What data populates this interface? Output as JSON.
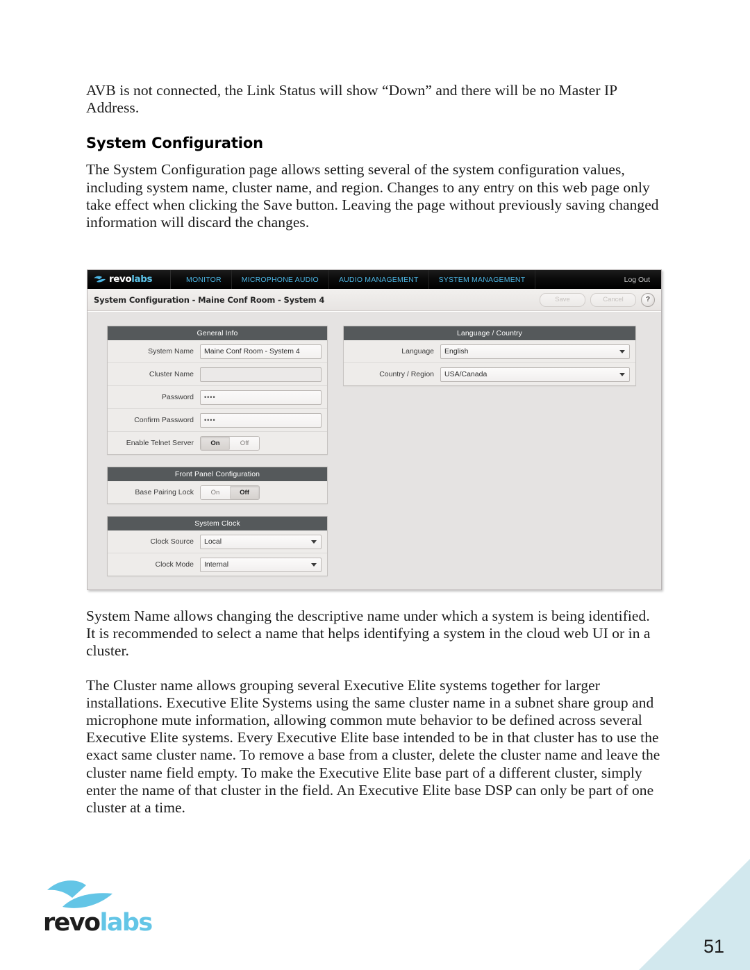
{
  "document": {
    "paragraph_1": "AVB is not connected, the Link Status will show “Down” and there will be no Master IP Address.",
    "heading_1": "System Configuration",
    "paragraph_2": "The System Configuration page allows setting several of the system configuration values, including system name, cluster name, and region.  Changes to any entry on this web page only take effect when clicking the Save button.  Leaving the page without previously saving changed information will discard the changes.",
    "paragraph_3": "System Name allows changing the descriptive name under which a system is being identified.  It is recommended to select a name that helps identifying a system in the cloud web UI or in a cluster.",
    "paragraph_4": "The Cluster name allows grouping several Executive Elite systems together for larger installations.  Executive Elite Systems using the same cluster name in a subnet share group and microphone mute information, allowing common mute behavior to be defined across several Executive Elite systems.  Every Executive Elite base intended to be in that cluster has to use the exact same cluster name.  To remove a base from a cluster, delete the cluster name and leave the cluster name field empty.  To make the Executive Elite base part of a different cluster, simply enter the name of that cluster in the field.  An Executive Elite base DSP can only be part of one cluster at a time."
  },
  "screenshot": {
    "brand": {
      "part_1": "revo",
      "part_2": "labs",
      "icon": "bird-logo-icon"
    },
    "nav": {
      "items": [
        {
          "label": "MONITOR",
          "name": "nav-monitor"
        },
        {
          "label": "MICROPHONE AUDIO",
          "name": "nav-microphone-audio"
        },
        {
          "label": "AUDIO MANAGEMENT",
          "name": "nav-audio-management"
        },
        {
          "label": "SYSTEM MANAGEMENT",
          "name": "nav-system-management"
        }
      ],
      "logout": "Log Out",
      "link_color": "#4db6e4"
    },
    "titlebar": {
      "title": "System Configuration - Maine Conf Room - System 4",
      "save_label": "Save",
      "cancel_label": "Cancel",
      "help_label": "?"
    },
    "panels": {
      "general_info": {
        "header": "General Info",
        "rows": [
          {
            "label": "System Name",
            "value": "Maine Conf Room - System 4",
            "type": "text"
          },
          {
            "label": "Cluster Name",
            "value": "",
            "type": "text"
          },
          {
            "label": "Password",
            "value": "••••",
            "type": "password"
          },
          {
            "label": "Confirm Password",
            "value": "••••",
            "type": "password"
          },
          {
            "label": "Enable Telnet Server",
            "type": "toggle",
            "on_label": "On",
            "off_label": "Off",
            "selected": "On"
          }
        ]
      },
      "front_panel": {
        "header": "Front Panel Configuration",
        "rows": [
          {
            "label": "Base Pairing Lock",
            "type": "toggle",
            "on_label": "On",
            "off_label": "Off",
            "selected": "Off"
          }
        ]
      },
      "system_clock": {
        "header": "System Clock",
        "rows": [
          {
            "label": "Clock Source",
            "value": "Local",
            "type": "select"
          },
          {
            "label": "Clock Mode",
            "value": "Internal",
            "type": "select"
          }
        ]
      },
      "language_country": {
        "header": "Language / Country",
        "rows": [
          {
            "label": "Language",
            "value": "English",
            "type": "select"
          },
          {
            "label": "Country / Region",
            "value": "USA/Canada",
            "type": "select"
          }
        ]
      }
    },
    "colors": {
      "panel_header_bg": "#55595b",
      "navbar_bg": "#000000",
      "workspace_bg": "#e5e3e2"
    }
  },
  "footer": {
    "logo": {
      "part_1": "revo",
      "part_2": "labs",
      "icon": "bird-logo-icon"
    },
    "page_number": "51",
    "corner_color": "#d2e8ee"
  }
}
